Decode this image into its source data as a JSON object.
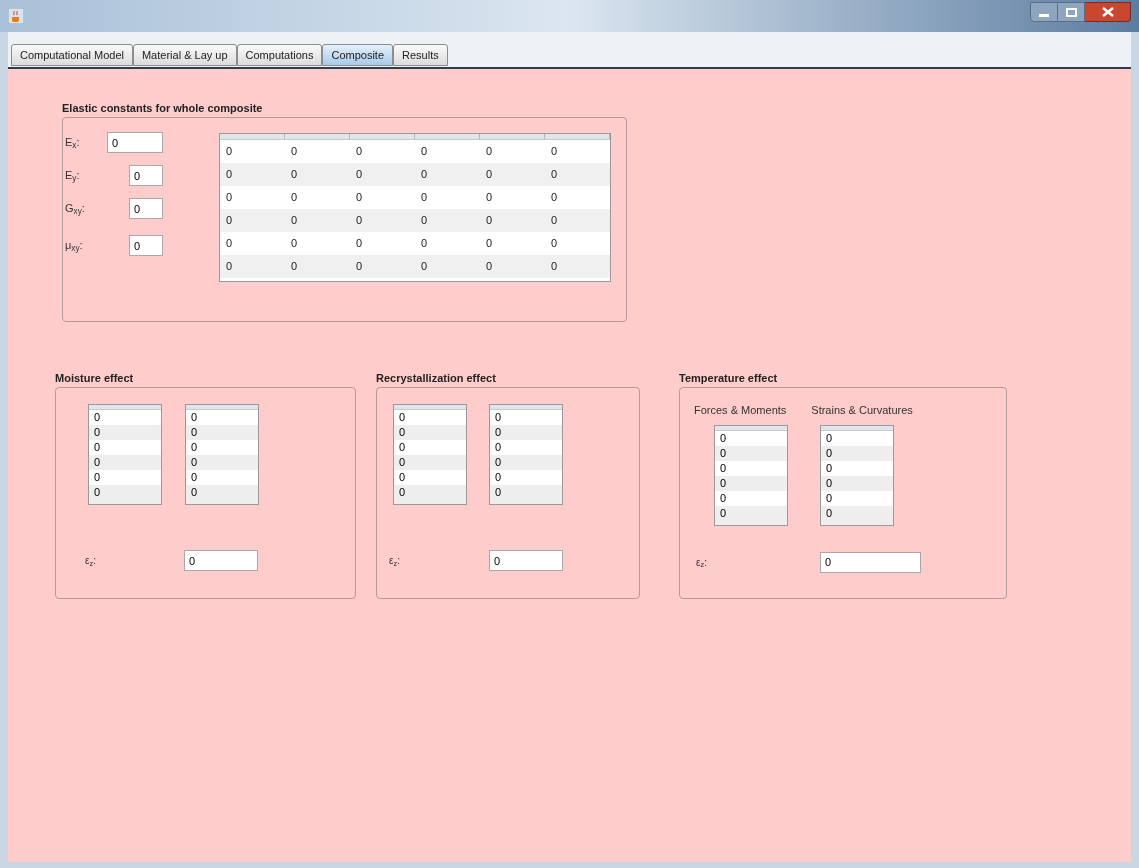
{
  "tabs": [
    {
      "label": "Computational Model",
      "selected": false
    },
    {
      "label": "Material & Lay up",
      "selected": false
    },
    {
      "label": "Computations",
      "selected": false
    },
    {
      "label": "Composite",
      "selected": true
    },
    {
      "label": "Results",
      "selected": false
    }
  ],
  "elastic_constants": {
    "title": "Elastic constants for whole composite",
    "fields": [
      {
        "label": "E$_{x}$:",
        "value": "0"
      },
      {
        "label": "E$_{y}$:",
        "value": "0"
      },
      {
        "label": "G$_{xy}$:",
        "value": "0"
      },
      {
        "label": "μ$_{xy}$:",
        "value": "0"
      }
    ],
    "table": {
      "rows": [
        [
          "0",
          "0",
          "0",
          "0",
          "0",
          "0"
        ],
        [
          "0",
          "0",
          "0",
          "0",
          "0",
          "0"
        ],
        [
          "0",
          "0",
          "0",
          "0",
          "0",
          "0"
        ],
        [
          "0",
          "0",
          "0",
          "0",
          "0",
          "0"
        ],
        [
          "0",
          "0",
          "0",
          "0",
          "0",
          "0"
        ],
        [
          "0",
          "0",
          "0",
          "0",
          "0",
          "0"
        ]
      ]
    }
  },
  "effects": [
    {
      "title": "Moisture effect",
      "lists": [
        {
          "rows": [
            "0",
            "0",
            "0",
            "0",
            "0",
            "0"
          ]
        },
        {
          "rows": [
            "0",
            "0",
            "0",
            "0",
            "0",
            "0"
          ]
        }
      ],
      "strain": {
        "label": "ε$_{z}$:",
        "value": "0"
      }
    },
    {
      "title": "Recrystallization effect",
      "lists": [
        {
          "rows": [
            "0",
            "0",
            "0",
            "0",
            "0",
            "0"
          ]
        },
        {
          "rows": [
            "0",
            "0",
            "0",
            "0",
            "0",
            "0"
          ]
        }
      ],
      "strain": {
        "label": "ε$_{z}$:",
        "value": "0"
      }
    },
    {
      "title": "Temperature effect",
      "lists": [
        {
          "heading": "Forces & Moments",
          "rows": [
            "0",
            "0",
            "0",
            "0",
            "0",
            "0"
          ]
        },
        {
          "heading": "Strains & Curvatures",
          "rows": [
            "0",
            "0",
            "0",
            "0",
            "0",
            "0"
          ]
        }
      ],
      "strain": {
        "label": "ε$_{z}$:",
        "value": "0"
      }
    }
  ]
}
